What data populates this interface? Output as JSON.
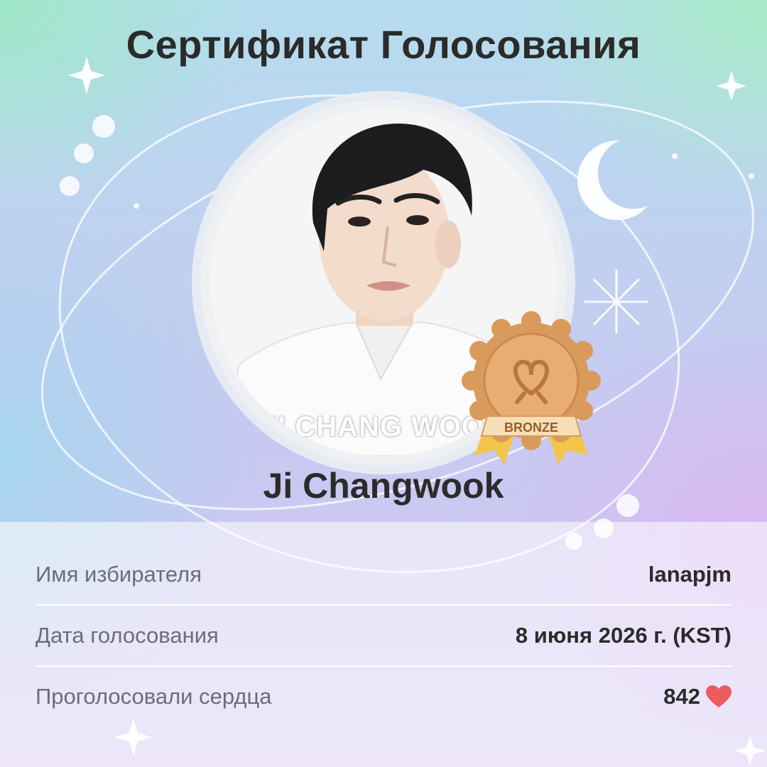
{
  "title": "Сертификат Голосования",
  "photo": {
    "caption": "JI CHANG WOOK"
  },
  "badge": {
    "label": "BRONZE",
    "color": "#d99a5b"
  },
  "candidate_name": "Ji Changwook",
  "details": [
    {
      "label": "Имя избирателя",
      "value": "lanapjm"
    },
    {
      "label": "Дата голосования",
      "value": "8 июня 2026 г. (KST)"
    },
    {
      "label": "Проголосовали сердца",
      "value": "842",
      "icon": "heart-icon"
    }
  ],
  "colors": {
    "heart": "#ec5b61",
    "text_dark": "#2b2b2b",
    "text_label": "#6d6d76"
  }
}
